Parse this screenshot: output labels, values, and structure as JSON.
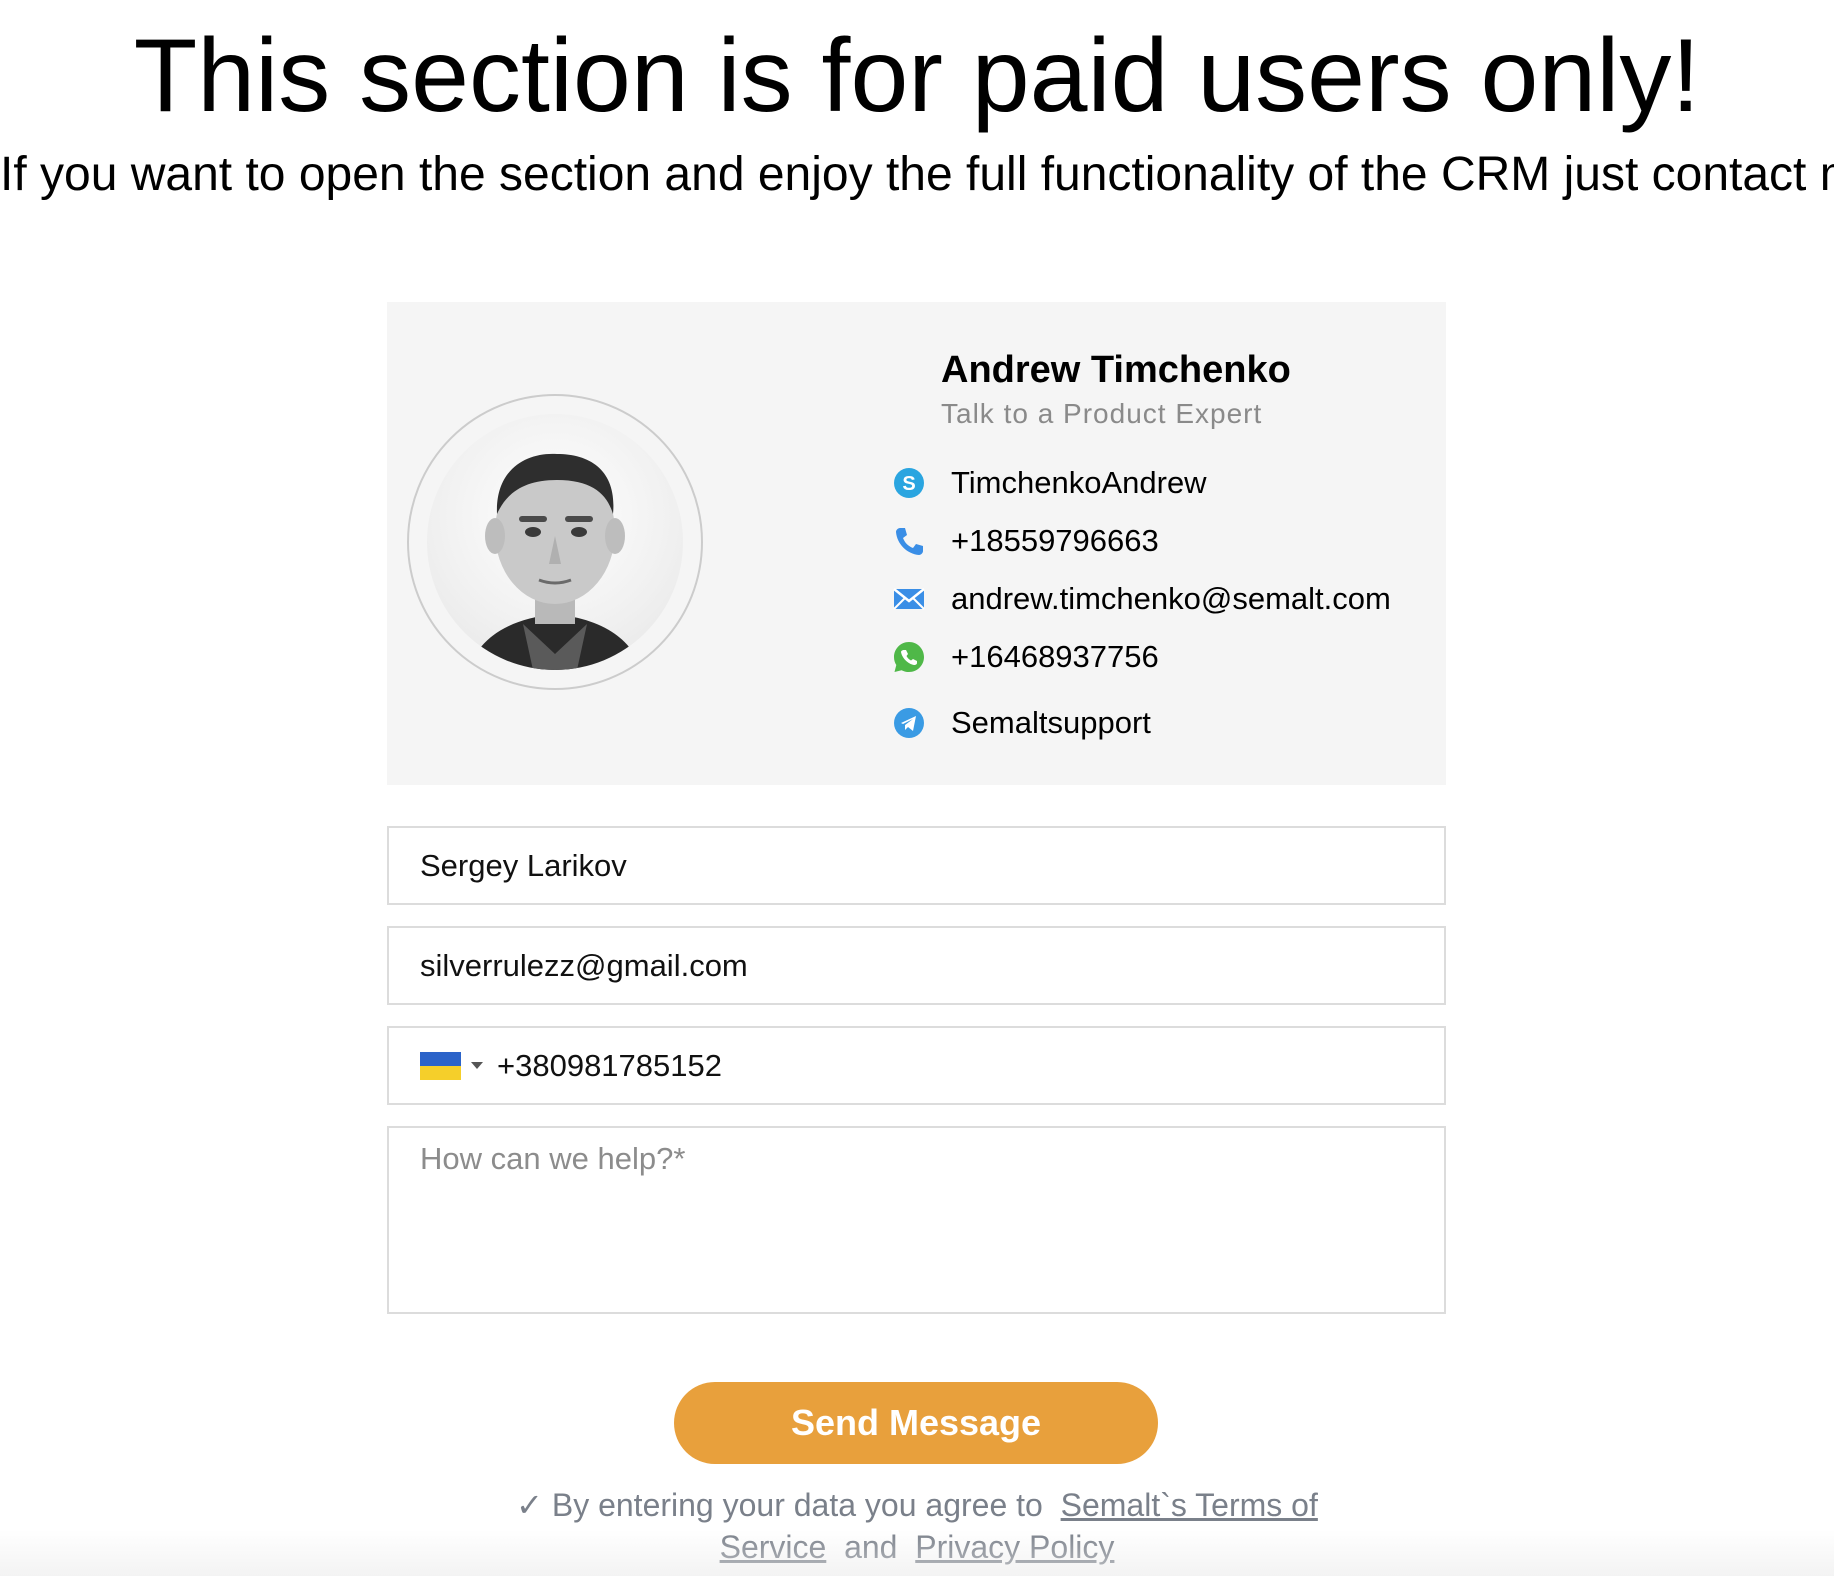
{
  "header": {
    "title": "This section is for paid users only!",
    "subtitle": "If you want to open the section and enjoy the full functionality of the CRM just contact me."
  },
  "contact_card": {
    "name": "Andrew Timchenko",
    "role": "Talk to a Product Expert",
    "items": [
      {
        "icon": "skype-icon",
        "value": "TimchenkoAndrew"
      },
      {
        "icon": "phone-icon",
        "value": "+18559796663"
      },
      {
        "icon": "email-icon",
        "value": "andrew.timchenko@semalt.com"
      },
      {
        "icon": "whatsapp-icon",
        "value": "+16468937756"
      },
      {
        "icon": "telegram-icon",
        "value": "Semaltsupport"
      }
    ]
  },
  "form": {
    "name_value": "Sergey Larikov",
    "email_value": "silverrulezz@gmail.com",
    "phone_country": "Ukraine",
    "phone_value": "+380981785152",
    "message_placeholder": "How can we help?*",
    "submit_label": "Send Message"
  },
  "agreement": {
    "check": "✓",
    "text": "By entering your data you agree to",
    "terms_link": "Semalt`s Terms of Service",
    "and": "and",
    "privacy_link": "Privacy Policy"
  },
  "colors": {
    "button": "#e8a03c",
    "card_bg": "#f5f5f5",
    "skype": "#2aa5e0",
    "phone": "#3a8ee6",
    "whatsapp": "#4fb848",
    "telegram": "#3a9be4"
  }
}
